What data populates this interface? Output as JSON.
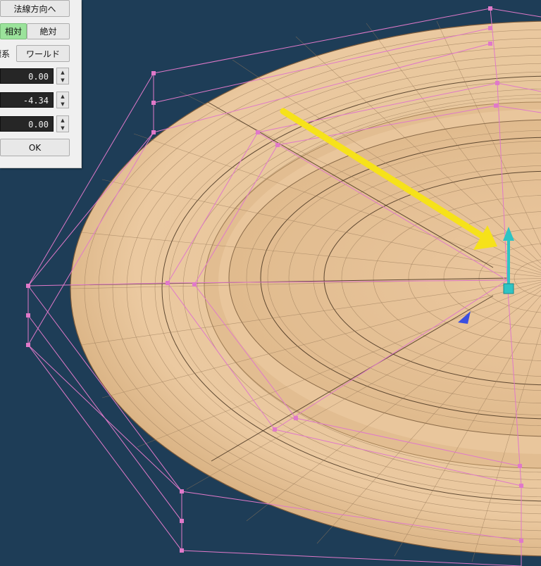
{
  "panel": {
    "normal_dir_button": "法線方向へ",
    "mode_relative": "相対",
    "mode_absolute": "絶対",
    "coord_label": "座標系",
    "coord_world_button": "ワールド",
    "values": [
      "0.00",
      "-4.34",
      "0.00"
    ],
    "ok_button": "OK"
  },
  "icons": {
    "spin_up": "▲",
    "spin_down": "▼"
  },
  "colors": {
    "background": "#1e3d57",
    "mesh": "#e9c59a",
    "cage": "#e079c9",
    "gizmo": "#2ec4c4",
    "arrow": "#f6e21a"
  }
}
